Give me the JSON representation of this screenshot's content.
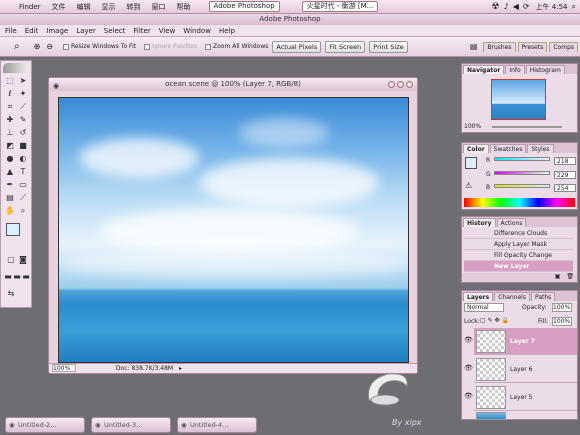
{
  "system": {
    "apple": "",
    "menus": [
      "Finder",
      "文件",
      "编辑",
      "显示",
      "转到",
      "窗口",
      "帮助"
    ],
    "tasks": [
      "Adobe Photoshop",
      "火星时代 - 衡游 [M..."
    ],
    "clock": "上午 4:54"
  },
  "app": {
    "title": "Adobe Photoshop",
    "menus": [
      "File",
      "Edit",
      "Image",
      "Layer",
      "Select",
      "Filter",
      "View",
      "Window",
      "Help"
    ]
  },
  "options": {
    "resize": "Resize Windows To Fit",
    "ignore": "Ignore Palettes",
    "zoom_all": "Zoom All Windows",
    "actual": "Actual Pixels",
    "fit": "Fit Screen",
    "print": "Print Size",
    "tabs": [
      "Brushes",
      "Presets",
      "Comps"
    ]
  },
  "document": {
    "title": "ocean scene @ 100% (Layer 7, RGB/8)",
    "zoom": "100%",
    "doc_size": "Doc: 838.7K/3.48M"
  },
  "navigator": {
    "tabs": [
      "Navigator",
      "Info",
      "Histogram"
    ],
    "zoom": "100%"
  },
  "color": {
    "tabs": [
      "Color",
      "Swatches",
      "Styles"
    ],
    "r_label": "R",
    "g_label": "G",
    "b_label": "B",
    "r": "218",
    "g": "229",
    "b": "254"
  },
  "history": {
    "tabs": [
      "History",
      "Actions"
    ],
    "items": [
      "Difference Clouds",
      "Apply Layer Mask",
      "Fill Opacity Change",
      "New Layer"
    ]
  },
  "layers": {
    "tabs": [
      "Layers",
      "Channels",
      "Paths"
    ],
    "blend": "Normal",
    "opacity_label": "Opacity:",
    "opacity": "100%",
    "lock_label": "Lock:",
    "fill_label": "Fill:",
    "fill": "100%",
    "items": [
      "Layer 7",
      "Layer 6",
      "Layer 5"
    ]
  },
  "bottom": {
    "tabs": [
      "Untitled-2...",
      "Untitled-3...",
      "Untitled-4..."
    ]
  },
  "watermark": "By xipx"
}
